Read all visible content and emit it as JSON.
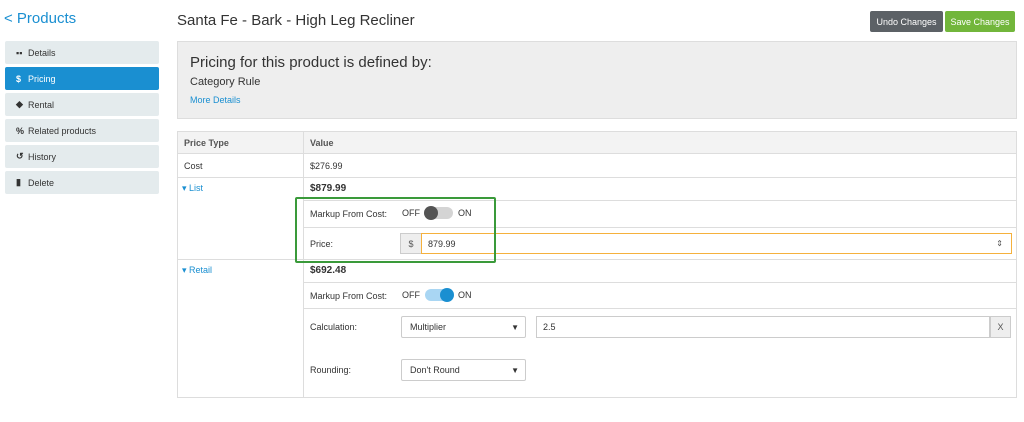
{
  "nav": {
    "back_label": "< Products",
    "items": [
      {
        "label": "Details",
        "icon": "grid-icon",
        "glyph": "▪▪"
      },
      {
        "label": "Pricing",
        "icon": "dollar-icon",
        "glyph": "$"
      },
      {
        "label": "Rental",
        "icon": "tag-icon",
        "glyph": "◆"
      },
      {
        "label": "Related products",
        "icon": "link-icon",
        "glyph": "%"
      },
      {
        "label": "History",
        "icon": "history-icon",
        "glyph": "↺"
      },
      {
        "label": "Delete",
        "icon": "trash-icon",
        "glyph": "▮"
      }
    ],
    "active_index": 1
  },
  "header": {
    "title": "Santa Fe - Bark - High Leg Recliner",
    "undo_label": "Undo Changes",
    "save_label": "Save Changes"
  },
  "info": {
    "title": "Pricing for this product is defined by:",
    "rule": "Category Rule",
    "link": "More Details"
  },
  "table": {
    "col_price_type": "Price Type",
    "col_value": "Value",
    "cost": {
      "label": "Cost",
      "value": "$276.99"
    },
    "list": {
      "label": "▾ List",
      "price": "$879.99",
      "markup_label": "Markup From Cost:",
      "toggle_off": "OFF",
      "toggle_on": "ON",
      "markup_on": false,
      "price_label": "Price:",
      "currency": "$",
      "price_value": "879.99",
      "spin_glyph": "⇕"
    },
    "retail": {
      "label": "▾ Retail",
      "price": "$692.48",
      "markup_label": "Markup From Cost:",
      "toggle_off": "OFF",
      "toggle_on": "ON",
      "markup_on": true,
      "calc_label": "Calculation:",
      "calc_select": "Multiplier",
      "calc_value": "2.5",
      "calc_suffix": "X",
      "rounding_label": "Rounding:",
      "rounding_select": "Don't Round"
    }
  },
  "colors": {
    "accent": "#1a8fd1",
    "save": "#72b63b",
    "undo": "#5c6166",
    "highlight": "#3a9a3a"
  }
}
